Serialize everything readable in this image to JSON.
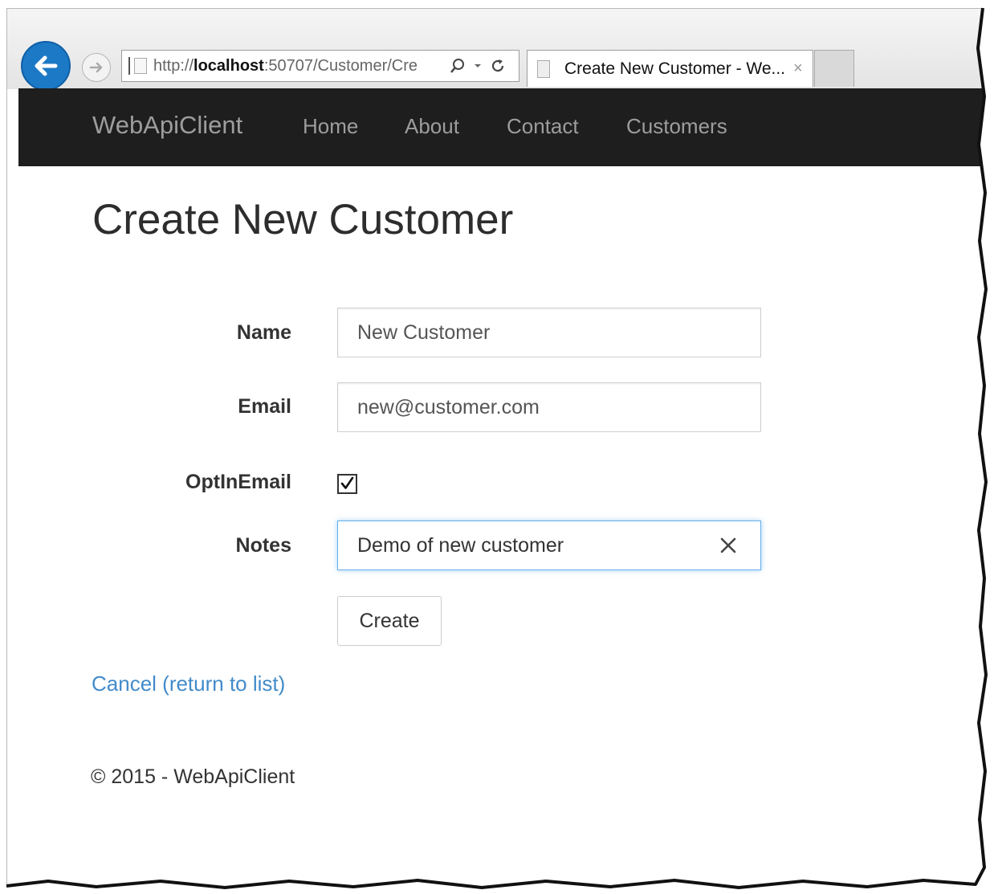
{
  "browser": {
    "url_prefix": "http://",
    "url_host": "localhost",
    "url_rest": ":50707/Customer/Cre",
    "tab_title": "Create New Customer - We...",
    "tab_close": "×"
  },
  "navbar": {
    "brand": "WebApiClient",
    "links": [
      "Home",
      "About",
      "Contact",
      "Customers"
    ]
  },
  "page": {
    "title": "Create New Customer"
  },
  "form": {
    "name_label": "Name",
    "name_value": "New Customer",
    "email_label": "Email",
    "email_value": "new@customer.com",
    "optin_label": "OptInEmail",
    "optin_checked": true,
    "notes_label": "Notes",
    "notes_value": "Demo of new customer",
    "create_label": "Create"
  },
  "links": {
    "cancel": "Cancel (return to list)"
  },
  "footer": {
    "text": "© 2015 - WebApiClient"
  },
  "colors": {
    "navbar_bg": "#1e1e1e",
    "nav_text": "#9d9d9d",
    "link": "#428bca",
    "back_button": "#1c79c6",
    "focus_border": "#66afe9"
  }
}
